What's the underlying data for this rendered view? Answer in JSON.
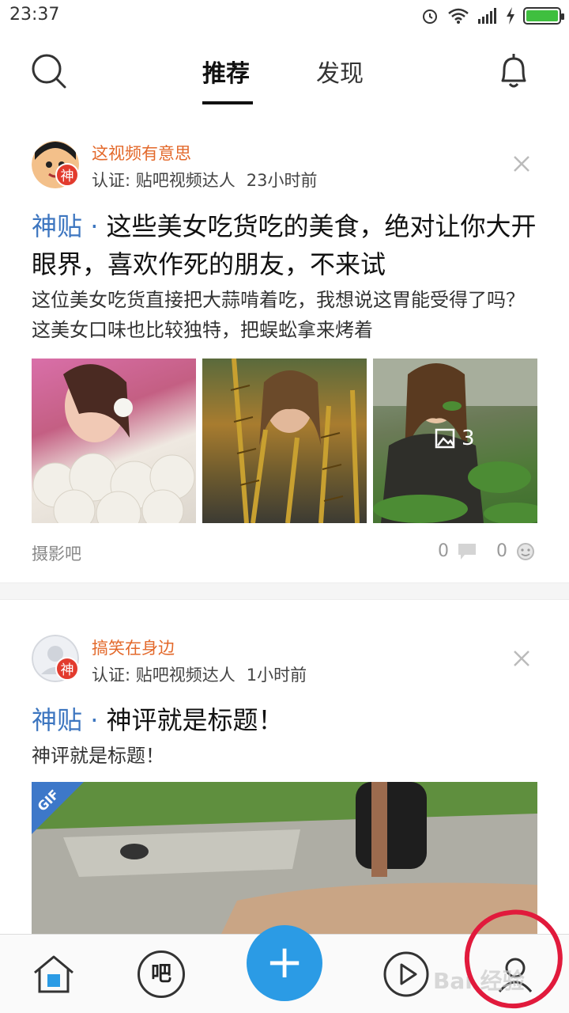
{
  "status_bar": {
    "time": "23:37"
  },
  "header": {
    "tabs": [
      {
        "label": "推荐"
      },
      {
        "label": "发现"
      }
    ]
  },
  "posts": [
    {
      "author": "这视频有意思",
      "badge": "神",
      "verified": "认证: 贴吧视频达人",
      "time": "23小时前",
      "tag": "神贴",
      "title": "这些美女吃货吃的美食，绝对让你大开眼界，喜欢作死的朋友，不来试",
      "excerpt": " 这位美女吃货直接把大蒜啃着吃，我想说这胃能受得了吗？这美女口味也比较独特，把蜈蚣拿来烤着",
      "photo_count": "3",
      "bar_name": "摄影吧",
      "comments": "0",
      "likes": "0"
    },
    {
      "author": "搞笑在身边",
      "badge": "神",
      "verified": "认证: 贴吧视频达人",
      "time": "1小时前",
      "tag": "神贴",
      "title": "神评就是标题！",
      "excerpt": "神评就是标题！",
      "gif_label": "GIF"
    }
  ],
  "bottom_bar": {
    "bar_label": "吧",
    "watermark": "Bai 经验"
  },
  "colors": {
    "author": "#e3692b",
    "tag": "#3d76c0",
    "compose": "#2b9be5",
    "highlight": "#e11a3c"
  }
}
